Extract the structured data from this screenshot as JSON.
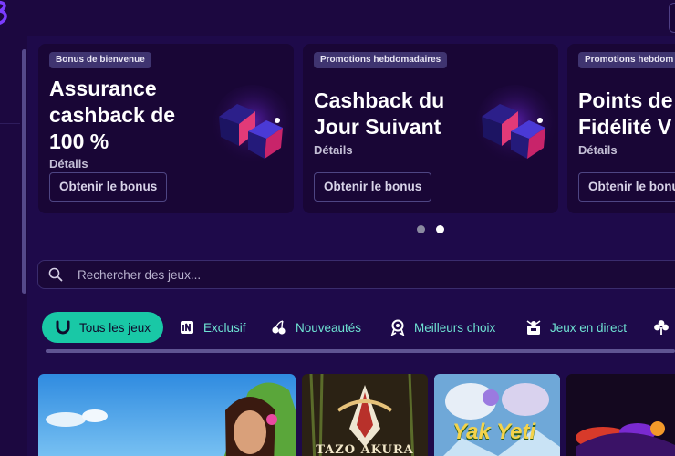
{
  "promos": [
    {
      "badge": "Bonus de bienvenue",
      "title": "Assurance\ncashback de\n100 %",
      "details": "Détails",
      "button": "Obtenir le bonus"
    },
    {
      "badge": "Promotions hebdomadaires",
      "title": "Cashback du\nJour Suivant",
      "details": "Détails",
      "button": "Obtenir le bonus"
    },
    {
      "badge": "Promotions hebdom",
      "title": "Points de\nFidélité V",
      "details": "Détails",
      "button": "Obtenir le bonu"
    }
  ],
  "carousel": {
    "page_count": 2,
    "active_index": 1
  },
  "search": {
    "placeholder": "Rechercher des jeux..."
  },
  "categories": [
    {
      "label": "Tous les jeux",
      "icon": "horseshoe-icon",
      "active": true
    },
    {
      "label": "Exclusif",
      "icon": "exclusive-icon",
      "active": false
    },
    {
      "label": "Nouveautés",
      "icon": "cherries-icon",
      "active": false
    },
    {
      "label": "Meilleurs choix",
      "icon": "medal-icon",
      "active": false
    },
    {
      "label": "Jeux en direct",
      "icon": "live-dealer-icon",
      "active": false
    },
    {
      "label": "",
      "icon": "clover-icon",
      "active": false
    }
  ],
  "games": [
    {
      "name": "",
      "icon": "game-thumbnail"
    },
    {
      "name": "TAZO AKURA",
      "icon": "game-thumbnail"
    },
    {
      "name": "Yak Yeti",
      "icon": "game-thumbnail"
    },
    {
      "name": "",
      "icon": "game-thumbnail"
    }
  ],
  "colors": {
    "background": "#1e0a4a",
    "card": "#190636",
    "accent": "#19c8a6",
    "tab_text": "#6fe3d3"
  }
}
